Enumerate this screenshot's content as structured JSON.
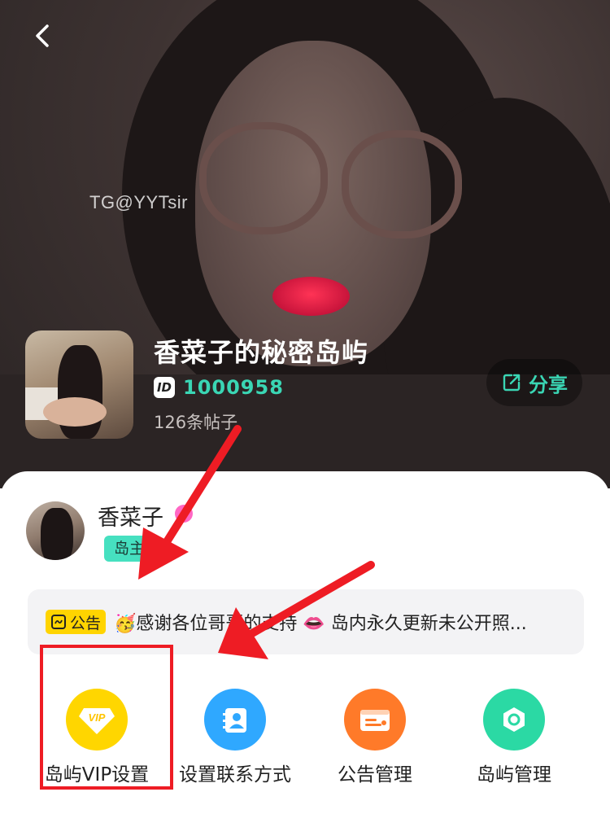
{
  "header": {
    "back_icon": "chevron-left-icon"
  },
  "watermark": "TG@YYTsir",
  "island": {
    "title": "香菜子的秘密岛屿",
    "id_badge": "ID",
    "id_value": "1000958",
    "post_count": "126条帖子"
  },
  "share": {
    "label": "分享",
    "icon": "share-icon"
  },
  "owner": {
    "name": "香菜子",
    "role": "岛主"
  },
  "notice": {
    "tag": "公告",
    "text": "🥳感谢各位哥哥的支持 👄 岛内永久更新未公开照..."
  },
  "actions": [
    {
      "label": "岛屿VIP设置",
      "icon": "vip-diamond-icon",
      "color": "#ffd600"
    },
    {
      "label": "设置联系方式",
      "icon": "contact-card-icon",
      "color": "#2fa8ff"
    },
    {
      "label": "公告管理",
      "icon": "announcement-card-icon",
      "color": "#ff7a29"
    },
    {
      "label": "岛屿管理",
      "icon": "island-settings-icon",
      "color": "#2bd9a4"
    }
  ],
  "colors": {
    "accent": "#3ad6b4",
    "annotation_red": "#ee1c24",
    "notice_tag": "#ffd400"
  }
}
